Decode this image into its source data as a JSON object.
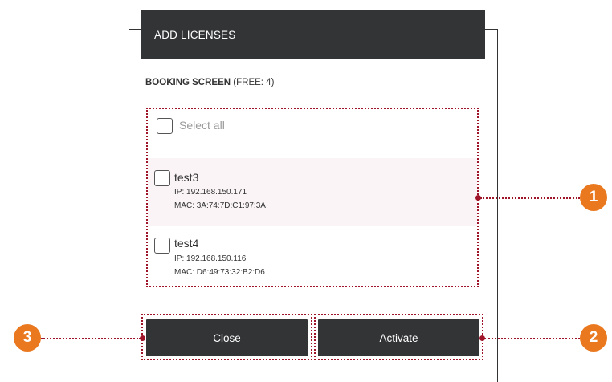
{
  "dialog": {
    "title": "ADD LICENSES",
    "section_label": "BOOKING SCREEN",
    "free_text": "(FREE: 4)",
    "select_all_label": "Select all",
    "devices": [
      {
        "name": "test3",
        "ip": "IP: 192.168.150.171",
        "mac": "MAC: 3A:74:7D:C1:97:3A",
        "checked": false
      },
      {
        "name": "test4",
        "ip": "IP: 192.168.150.116",
        "mac": "MAC: D6:49:73:32:B2:D6",
        "checked": false
      }
    ],
    "buttons": {
      "close_label": "Close",
      "activate_label": "Activate"
    }
  },
  "callouts": [
    "1",
    "2",
    "3"
  ],
  "colors": {
    "header_bg": "#333436",
    "button_bg": "#333436",
    "callout_badge": "#e9781f",
    "callout_line": "#a0142a",
    "row_highlight": "#faf4f7"
  }
}
